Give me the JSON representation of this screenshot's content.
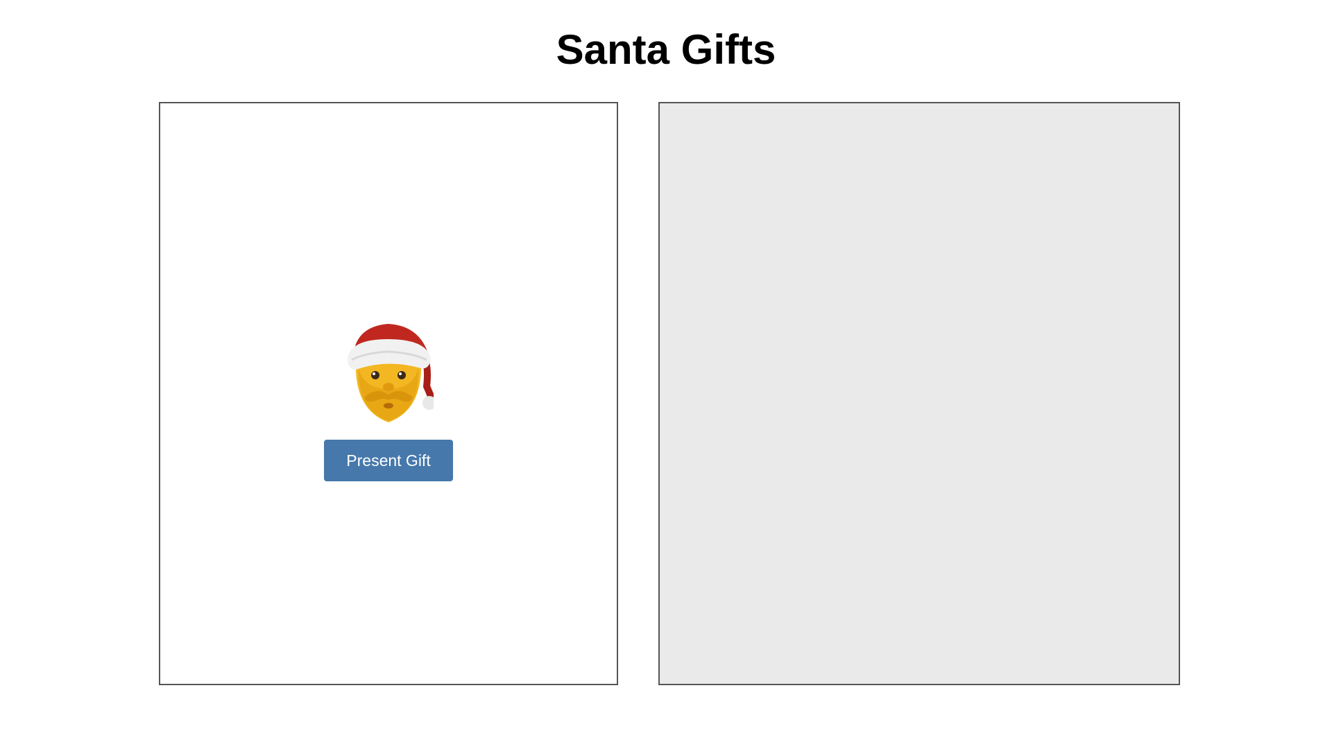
{
  "header": {
    "title": "Santa Gifts"
  },
  "santa_panel": {
    "icon": "santa-claus-icon",
    "button_label": "Present Gift"
  },
  "gift_panel": {
    "background_color": "#eaeaea"
  },
  "colors": {
    "button": "#4678ab",
    "panel_border": "#555555"
  }
}
